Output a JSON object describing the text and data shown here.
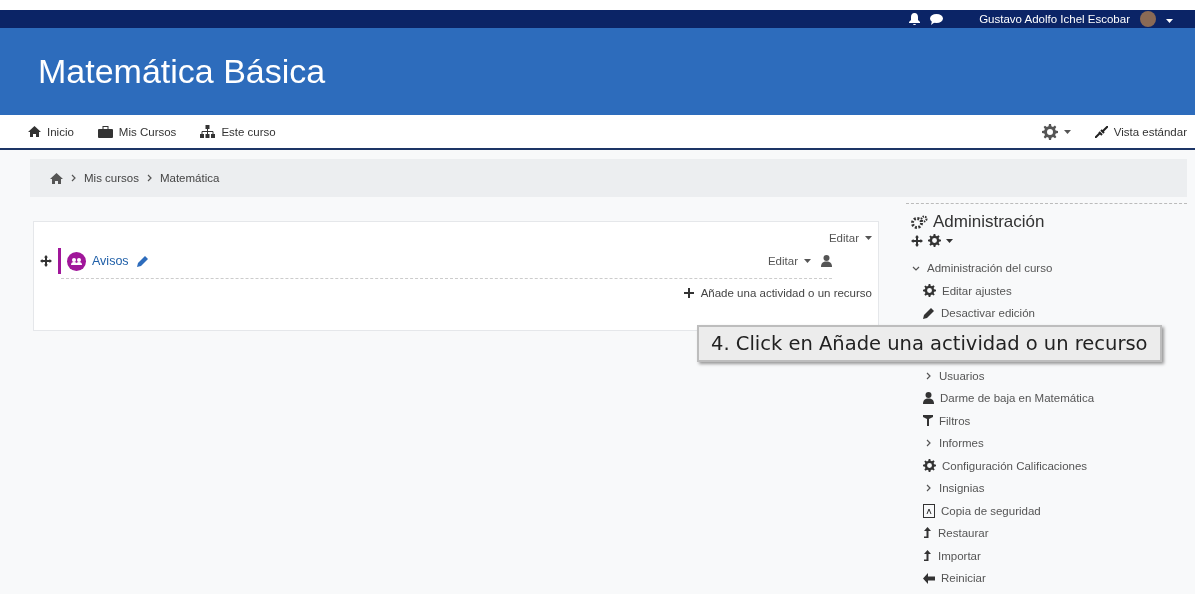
{
  "top_bar": {
    "user_name": "Gustavo Adolfo Ichel Escobar"
  },
  "course": {
    "title": "Matemática Básica"
  },
  "nav": {
    "items": [
      {
        "label": "Inicio",
        "kind": "home"
      },
      {
        "label": "Mis Cursos",
        "kind": "briefcase"
      },
      {
        "label": "Este curso",
        "kind": "sitemap"
      }
    ],
    "view_label": "Vista estándar"
  },
  "breadcrumb": [
    "Mis cursos",
    "Matemática"
  ],
  "section": {
    "edit_label": "Editar",
    "activity": {
      "title": "Avisos",
      "edit_label": "Editar"
    },
    "add_label": "Añade una actividad o un recurso"
  },
  "callout": {
    "text": "4. Click en Añade una actividad o un recurso"
  },
  "administration": {
    "title": "Administración",
    "items": [
      {
        "label": "Administración del curso",
        "kind": "branch",
        "expanded": true,
        "children": [
          {
            "label": "Editar ajustes",
            "kind": "settings"
          },
          {
            "label": "Desactivar edición",
            "kind": "edit"
          },
          {
            "label": "Usuarios",
            "kind": "branch",
            "expanded": false
          },
          {
            "label": "Darme de baja en Matemática",
            "kind": "user"
          },
          {
            "label": "Filtros",
            "kind": "filter"
          },
          {
            "label": "Informes",
            "kind": "branch",
            "expanded": false
          },
          {
            "label": "Configuración Calificaciones",
            "kind": "settings"
          },
          {
            "label": "Insignias",
            "kind": "branch",
            "expanded": false
          },
          {
            "label": "Copia de seguridad",
            "kind": "backup"
          },
          {
            "label": "Restaurar",
            "kind": "restore"
          },
          {
            "label": "Importar",
            "kind": "restore"
          },
          {
            "label": "Reiniciar",
            "kind": "back"
          }
        ]
      }
    ]
  }
}
